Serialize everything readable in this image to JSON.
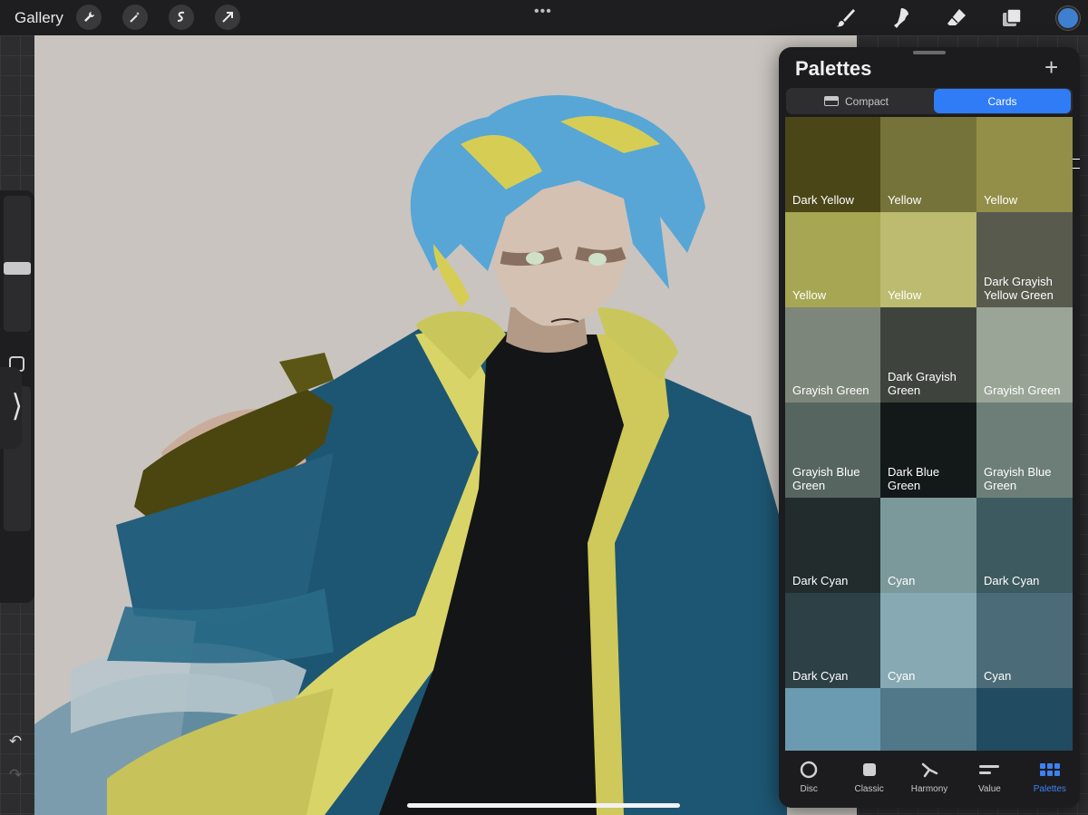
{
  "topbar": {
    "gallery_label": "Gallery",
    "left_tools": [
      "wrench-icon",
      "magic-wand-icon",
      "selection-icon",
      "transform-arrow-icon"
    ],
    "center_menu": "•••",
    "right_tools": [
      "brush-icon",
      "smudge-icon",
      "eraser-icon",
      "layers-icon"
    ],
    "current_color": "#3f7fd0"
  },
  "panel": {
    "title": "Palettes",
    "add_label": "+",
    "view_modes": [
      {
        "label": "Compact",
        "active": false
      },
      {
        "label": "Cards",
        "active": true
      }
    ],
    "accent": "#2f7cf6",
    "swatches": [
      {
        "label": "Dark Yellow",
        "color": "#4a4618"
      },
      {
        "label": "Yellow",
        "color": "#76733a"
      },
      {
        "label": "Yellow",
        "color": "#938f48"
      },
      {
        "label": "Yellow",
        "color": "#a6a653"
      },
      {
        "label": "Yellow",
        "color": "#bcbb70"
      },
      {
        "label": "Dark Grayish Yellow Green",
        "color": "#575a4d"
      },
      {
        "label": "Grayish Green",
        "color": "#7d867a"
      },
      {
        "label": "Dark Grayish Green",
        "color": "#3e443d"
      },
      {
        "label": "Grayish Green",
        "color": "#9aa597"
      },
      {
        "label": "Grayish Blue Green",
        "color": "#566560"
      },
      {
        "label": "Dark Blue Green",
        "color": "#131918"
      },
      {
        "label": "Grayish Blue Green",
        "color": "#6d7e79"
      },
      {
        "label": "Dark Cyan",
        "color": "#222c2d"
      },
      {
        "label": "Cyan",
        "color": "#7b999a"
      },
      {
        "label": "Dark Cyan",
        "color": "#3d5a60"
      },
      {
        "label": "Dark Cyan",
        "color": "#2c4046"
      },
      {
        "label": "Cyan",
        "color": "#86a9b4"
      },
      {
        "label": "Cyan",
        "color": "#4a6b77"
      },
      {
        "label": "",
        "color": "#6a9bb0"
      },
      {
        "label": "",
        "color": "#507889"
      },
      {
        "label": "",
        "color": "#214b60"
      }
    ]
  },
  "bottom_nav": [
    {
      "label": "Disc",
      "icon": "disc-icon",
      "active": false
    },
    {
      "label": "Classic",
      "icon": "classic-square-icon",
      "active": false
    },
    {
      "label": "Harmony",
      "icon": "harmony-icon",
      "active": false
    },
    {
      "label": "Value",
      "icon": "value-sliders-icon",
      "active": false
    },
    {
      "label": "Palettes",
      "icon": "palettes-grid-icon",
      "active": true
    }
  ]
}
